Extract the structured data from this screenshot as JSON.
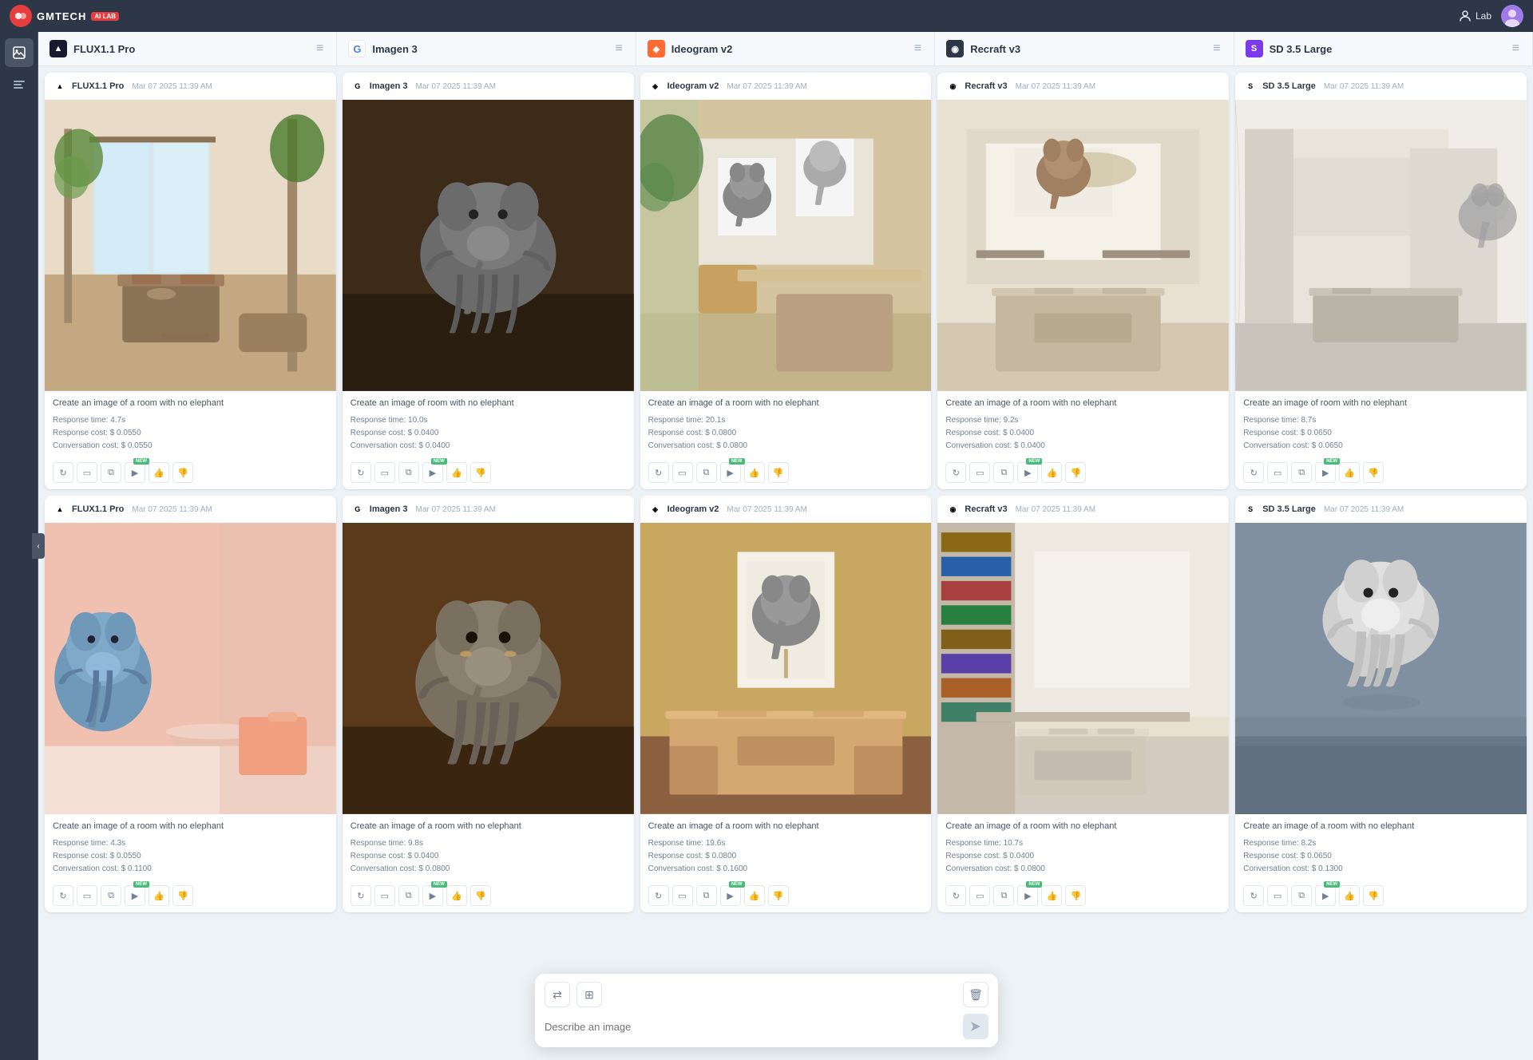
{
  "app": {
    "name": "GMTECH",
    "badge": "AI LAB",
    "nav_user": "Lab"
  },
  "models": [
    {
      "id": "flux",
      "name": "FLUX1.1 Pro",
      "logo": "▲",
      "logo_class": "flux",
      "color": "#1a1a2e"
    },
    {
      "id": "google",
      "name": "Imagen 3",
      "logo": "G",
      "logo_class": "google",
      "color": "#4285f4"
    },
    {
      "id": "ideogram",
      "name": "Ideogram v2",
      "logo": "◈",
      "logo_class": "ideogram",
      "color": "#ff6b35"
    },
    {
      "id": "recraft",
      "name": "Recraft v3",
      "logo": "◉",
      "logo_class": "recraft",
      "color": "#2d3748"
    },
    {
      "id": "stability",
      "name": "SD 3.5 Large",
      "logo": "S",
      "logo_class": "stability",
      "color": "#7c3aed"
    }
  ],
  "rows": [
    {
      "cards": [
        {
          "model_idx": 0,
          "timestamp": "Mar 07 2025 11:39 AM",
          "prompt": "Create an image of a room with no elephant",
          "response_time": "4.7s",
          "cost": "$ 0.0550",
          "conv_cost": "$ 0.0550",
          "scene": "room_plants"
        },
        {
          "model_idx": 1,
          "timestamp": "Mar 07 2025 11:39 AM",
          "prompt": "Create an image of room with no elephant",
          "response_time": "10.0s",
          "cost": "$ 0.0400",
          "conv_cost": "$ 0.0400",
          "scene": "elephant_dark"
        },
        {
          "model_idx": 2,
          "timestamp": "Mar 07 2025 11:39 AM",
          "prompt": "Create an image of a room with no elephant",
          "response_time": "20.1s",
          "cost": "$ 0.0800",
          "conv_cost": "$ 0.0800",
          "scene": "room_elephant_art"
        },
        {
          "model_idx": 3,
          "timestamp": "Mar 07 2025 11:39 AM",
          "prompt": "Create an image of a room with no elephant",
          "response_time": "9.2s",
          "cost": "$ 0.0400",
          "conv_cost": "$ 0.0400",
          "scene": "room_elephant_painting"
        },
        {
          "model_idx": 4,
          "timestamp": "Mar 07 2025 11:39 AM",
          "prompt": "Create an image of room with no elephant",
          "response_time": "8.7s",
          "cost": "$ 0.0650",
          "conv_cost": "$ 0.0650",
          "scene": "room_elephant_small"
        }
      ]
    },
    {
      "cards": [
        {
          "model_idx": 0,
          "timestamp": "Mar 07 2025 11:39 AM",
          "prompt": "Create an image of a room with no elephant",
          "response_time": "4.3s",
          "cost": "$ 0.0550",
          "conv_cost": "$ 0.1100",
          "scene": "pink_room_elephant"
        },
        {
          "model_idx": 1,
          "timestamp": "Mar 07 2025 11:39 AM",
          "prompt": "Create an image of a room with no elephant",
          "response_time": "9.8s",
          "cost": "$ 0.0400",
          "conv_cost": "$ 0.0800",
          "scene": "elephant_brown"
        },
        {
          "model_idx": 2,
          "timestamp": "Mar 07 2025 11:39 AM",
          "prompt": "Create an image of a room with no elephant",
          "response_time": "19.6s",
          "cost": "$ 0.0800",
          "conv_cost": "$ 0.1600",
          "scene": "room_elephant_poster"
        },
        {
          "model_idx": 3,
          "timestamp": "Mar 07 2025 11:39 AM",
          "prompt": "Create an image of a room with no elephant",
          "response_time": "10.7s",
          "cost": "$ 0.0400",
          "conv_cost": "$ 0.0800",
          "scene": "room_bookshelf"
        },
        {
          "model_idx": 4,
          "timestamp": "Mar 07 2025 11:39 AM",
          "prompt": "Create an image of a room with no elephant",
          "response_time": "8.2s",
          "cost": "$ 0.0650",
          "conv_cost": "$ 0.1300",
          "scene": "gray_room_elephant"
        }
      ]
    }
  ],
  "bottom_bar": {
    "placeholder": "Describe an image",
    "switch_label": "⇄",
    "grid_label": "⊞"
  }
}
